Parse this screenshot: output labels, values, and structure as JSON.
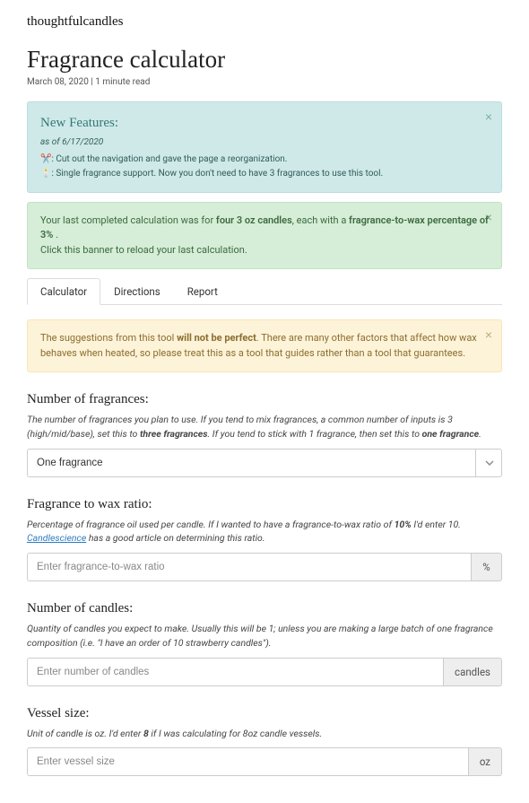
{
  "brand": "thoughtfulcandles",
  "title": "Fragrance calculator",
  "meta": "March 08, 2020 | 1 minute read",
  "features": {
    "heading": "New Features:",
    "asof": "as of 6/17/2020",
    "item1_prefix": "✂️: ",
    "item1_text": "Cut out the navigation and gave the page a reorganization.",
    "item2_prefix": "🕯️: ",
    "item2_text": "Single fragrance support. Now you don't need to have 3 fragrances to use this tool."
  },
  "last": {
    "pre": "Your last completed calculation was for ",
    "bold1": "four 3 oz candles",
    "mid": ", each with a ",
    "bold2": "fragrance-to-wax percentage of 3%",
    "post": " .",
    "line2": "Click this banner to reload your last calculation."
  },
  "tabs": {
    "calculator": "Calculator",
    "directions": "Directions",
    "report": "Report"
  },
  "warning": {
    "pre": "The suggestions from this tool ",
    "bold": "will not be perfect",
    "post": ". There are many other factors that affect how wax behaves when heated, so please treat this as a tool that guides rather than a tool that guarantees."
  },
  "num_frag": {
    "label": "Number of fragrances:",
    "help_a": "The number of fragrances you plan to use. If you tend to mix fragrances, a common number of inputs is 3 (high/mid/base), set this to ",
    "help_b": "three fragrances",
    "help_c": ". If you tend to stick with 1 fragrance, then set this to ",
    "help_d": "one fragrance",
    "help_e": ".",
    "value": "One fragrance"
  },
  "ratio": {
    "label": "Fragrance to wax ratio:",
    "help_a": "Percentage of fragrance oil used per candle. If I wanted to have a fragrance-to-wax ratio of ",
    "help_b": "10%",
    "help_c": " I'd enter 10. ",
    "link": "Candlescience",
    "help_d": " has a good article on determining this ratio.",
    "placeholder": "Enter fragrance-to-wax ratio",
    "addon": "%"
  },
  "num_candles": {
    "label": "Number of candles:",
    "help": "Quantity of candles you expect to make. Usually this will be 1; unless you are making a large batch of one fragrance composition (i.e. \"I have an order of 10 strawberry candles\").",
    "placeholder": "Enter number of candles",
    "addon": "candles"
  },
  "vessel": {
    "label": "Vessel size:",
    "help_a": "Unit of candle is oz. I'd enter ",
    "help_b": "8",
    "help_c": " if I was calculating for 8oz candle vessels.",
    "placeholder": "Enter vessel size",
    "addon": "oz"
  }
}
